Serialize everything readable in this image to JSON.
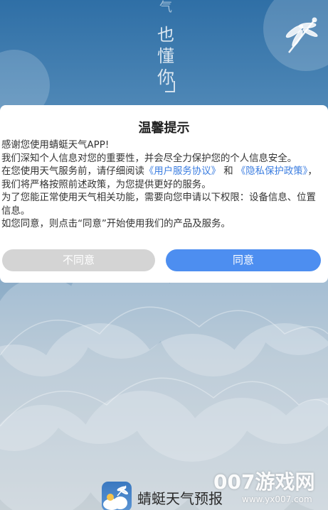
{
  "background": {
    "slogan": [
      "气",
      "也",
      "懂",
      "你"
    ]
  },
  "dialog": {
    "title": "温馨提示",
    "greeting": "感谢您使用蜻蜓天气APP!",
    "line1": "我们深知个人信息对您的重要性，并会尽全力保护您的个人信息安全。",
    "line2_prefix": "在您使用天气服务前，请仔细阅读",
    "user_agreement_link": "《用户服务协议》",
    "line2_and": "和",
    "privacy_policy_link": "《隐私保护政策》",
    "line2_suffix": "，我们将严格按照前述政策，为您提供更好的服务。",
    "line3": "为了您能正常使用天气相关功能，需要向您申请以下权限：设备信息、位置信息。",
    "line4": "如您同意，则点击“同意”开始使用我们的产品及服务。",
    "disagree_label": "不同意",
    "agree_label": "同意"
  },
  "brand": {
    "app_name": "蜻蜓天气预报"
  },
  "watermark": {
    "main": "007游戏网",
    "url": "www.yx007.com"
  },
  "colors": {
    "link": "#3b7de0",
    "agree_button": "#4d8ef0",
    "disagree_button": "#d4d4d4"
  }
}
